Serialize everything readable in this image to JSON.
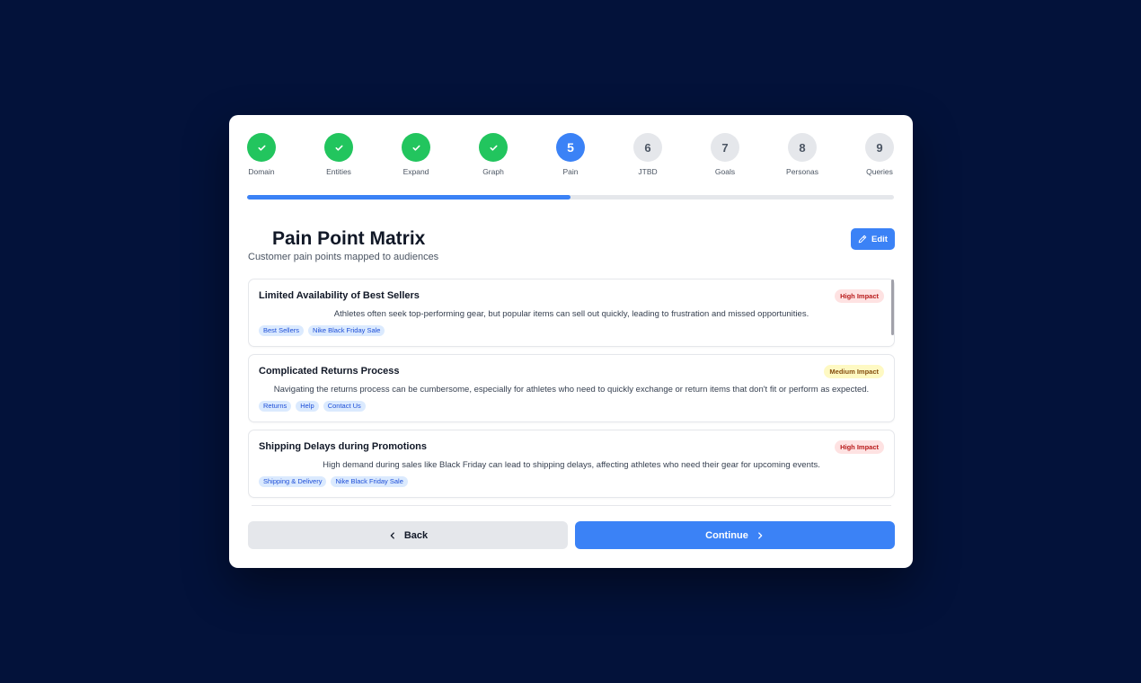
{
  "stepper": {
    "steps": [
      {
        "number": "1",
        "label": "Domain",
        "status": "completed",
        "icon": "check-icon"
      },
      {
        "number": "2",
        "label": "Entities",
        "status": "completed",
        "icon": "check-icon"
      },
      {
        "number": "3",
        "label": "Expand",
        "status": "completed",
        "icon": "check-icon"
      },
      {
        "number": "4",
        "label": "Graph",
        "status": "completed",
        "icon": "check-icon"
      },
      {
        "number": "5",
        "label": "Pain",
        "status": "current"
      },
      {
        "number": "6",
        "label": "JTBD",
        "status": "upcoming"
      },
      {
        "number": "7",
        "label": "Goals",
        "status": "upcoming"
      },
      {
        "number": "8",
        "label": "Personas",
        "status": "upcoming"
      },
      {
        "number": "9",
        "label": "Queries",
        "status": "upcoming"
      }
    ],
    "progress_fraction": 0.5
  },
  "header": {
    "title": "Pain Point Matrix",
    "subtitle": "Customer pain points mapped to audiences",
    "edit_label": "Edit",
    "edit_icon": "pencil-icon"
  },
  "pain_points": [
    {
      "title": "Limited Availability of Best Sellers",
      "impact": "High Impact",
      "impact_level": "high",
      "description": "Athletes often seek top-performing gear, but popular items can sell out quickly, leading to frustration and missed opportunities.",
      "tags": [
        "Best Sellers",
        "Nike Black Friday Sale"
      ]
    },
    {
      "title": "Complicated Returns Process",
      "impact": "Medium Impact",
      "impact_level": "medium",
      "description": "Navigating the returns process can be cumbersome, especially for athletes who need to quickly exchange or return items that don't fit or perform as expected.",
      "tags": [
        "Returns",
        "Help",
        "Contact Us"
      ]
    },
    {
      "title": "Shipping Delays during Promotions",
      "impact": "High Impact",
      "impact_level": "high",
      "description": "High demand during sales like Black Friday can lead to shipping delays, affecting athletes who need their gear for upcoming events.",
      "tags": [
        "Shipping & Delivery",
        "Nike Black Friday Sale"
      ]
    }
  ],
  "footer": {
    "back_label": "Back",
    "back_icon": "chevron-left-icon",
    "continue_label": "Continue",
    "continue_icon": "chevron-right-icon"
  },
  "colors": {
    "background": "#03123a",
    "completed": "#22c55e",
    "current": "#3b82f6",
    "upcoming": "#e5e7eb",
    "high_impact_bg": "#fee2e2",
    "medium_impact_bg": "#fef9c3",
    "tag_bg": "#dbeafe"
  }
}
